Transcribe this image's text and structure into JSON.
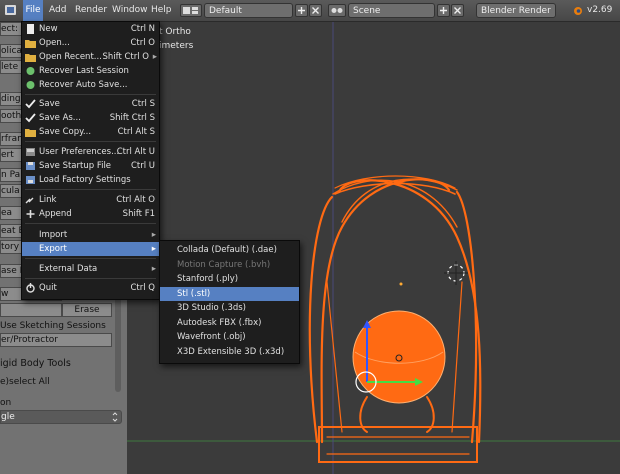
{
  "topbar": {
    "menus": [
      "File",
      "Add",
      "Render",
      "Window",
      "Help"
    ],
    "layout": "Default",
    "scene": "Scene",
    "engine": "Blender Render",
    "version": "v2.69"
  },
  "viewport": {
    "overlay_line1": "t Ortho",
    "overlay_line2": "imeters"
  },
  "left_panel": {
    "rows": [
      "ect:",
      "olicat",
      "lete",
      "ding:",
      "ooth",
      "rfram",
      "ert",
      "n Pa",
      "cula",
      "ea",
      "eat B",
      "tory",
      "ase P",
      "w"
    ],
    "erase_label": "Erase",
    "use_sketching": "Use Sketching Sessions",
    "protractor": "er/Protractor",
    "rigid_body_tools": "igid Body Tools",
    "select_all": "e)select All",
    "on_label": "on",
    "dropdown_value": "gle"
  },
  "file_menu": {
    "items": [
      {
        "label": "New",
        "shortcut": "Ctrl N",
        "icon": "new-file-icon"
      },
      {
        "label": "Open...",
        "shortcut": "Ctrl O",
        "icon": "open-folder-icon"
      },
      {
        "label": "Open Recent...",
        "shortcut": "Shift Ctrl O",
        "icon": "open-recent-icon"
      },
      {
        "label": "Recover Last Session",
        "shortcut": "",
        "icon": "recover-icon"
      },
      {
        "label": "Recover Auto Save...",
        "shortcut": "",
        "icon": "recover-auto-icon"
      },
      {
        "label": "Save",
        "shortcut": "Ctrl S",
        "icon": "save-check-icon"
      },
      {
        "label": "Save As...",
        "shortcut": "Shift Ctrl S",
        "icon": "save-as-icon"
      },
      {
        "label": "Save Copy...",
        "shortcut": "Ctrl Alt S",
        "icon": "save-copy-icon"
      },
      {
        "label": "User Preferences...",
        "shortcut": "Ctrl Alt U",
        "icon": "preferences-icon"
      },
      {
        "label": "Save Startup File",
        "shortcut": "Ctrl U",
        "icon": "save-startup-icon"
      },
      {
        "label": "Load Factory Settings",
        "shortcut": "",
        "icon": "factory-settings-icon"
      },
      {
        "label": "Link",
        "shortcut": "Ctrl Alt O",
        "icon": "link-icon"
      },
      {
        "label": "Append",
        "shortcut": "Shift F1",
        "icon": "append-icon"
      },
      {
        "label": "Import",
        "shortcut": "",
        "icon": "import-icon"
      },
      {
        "label": "Export",
        "shortcut": "",
        "icon": "export-icon"
      },
      {
        "label": "External Data",
        "shortcut": "",
        "icon": "external-data-icon"
      },
      {
        "label": "Quit",
        "shortcut": "Ctrl Q",
        "icon": "quit-icon"
      }
    ]
  },
  "export_menu": {
    "items": [
      "Collada (Default) (.dae)",
      "Motion Capture (.bvh)",
      "Stanford (.ply)",
      "Stl (.stl)",
      "3D Studio (.3ds)",
      "Autodesk FBX (.fbx)",
      "Wavefront (.obj)",
      "X3D Extensible 3D (.x3d)"
    ],
    "highlighted": "Stl (.stl)"
  },
  "colors": {
    "highlight": "#5680c2",
    "menu_bg": "#1e1e1e",
    "wire_orange": "#ff6a13",
    "viewport_bg": "#3b3b3b"
  }
}
